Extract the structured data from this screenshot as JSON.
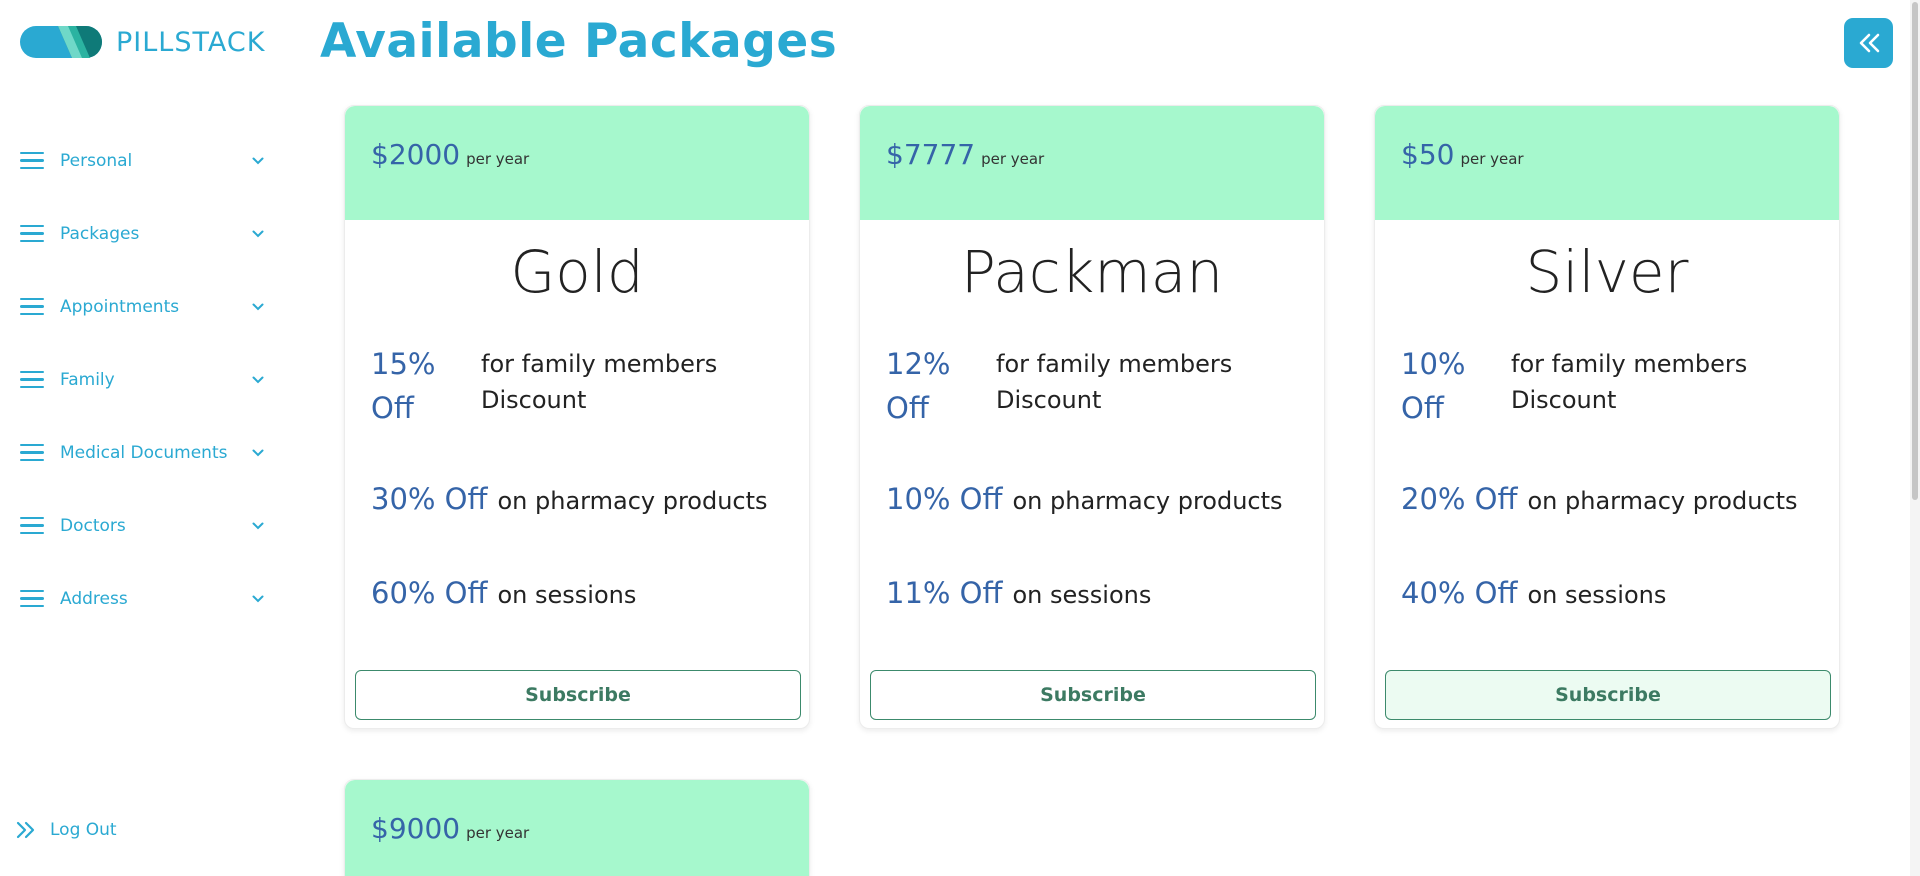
{
  "brand": {
    "name": "PILLSTACK"
  },
  "sidebar": {
    "items": [
      {
        "label": "Personal"
      },
      {
        "label": "Packages"
      },
      {
        "label": "Appointments"
      },
      {
        "label": "Family"
      },
      {
        "label": "Medical Documents"
      },
      {
        "label": "Doctors"
      },
      {
        "label": "Address"
      }
    ],
    "logout": "Log Out"
  },
  "header": {
    "title": "Available Packages"
  },
  "packages": [
    {
      "price": "$2000",
      "per": "per year",
      "name": "Gold",
      "family_pct": "15%",
      "family_off": "Off",
      "family_text": "for family members",
      "family_text2": "Discount",
      "pharmacy_pct": "30% Off",
      "pharmacy_text": "on pharmacy products",
      "sessions_pct": "60% Off",
      "sessions_text": "on sessions",
      "button": "Subscribe"
    },
    {
      "price": "$7777",
      "per": "per year",
      "name": "Packman",
      "family_pct": "12%",
      "family_off": "Off",
      "family_text": "for family members",
      "family_text2": "Discount",
      "pharmacy_pct": "10% Off",
      "pharmacy_text": "on pharmacy products",
      "sessions_pct": "11% Off",
      "sessions_text": "on sessions",
      "button": "Subscribe"
    },
    {
      "price": "$50",
      "per": "per year",
      "name": "Silver",
      "family_pct": "10%",
      "family_off": "Off",
      "family_text": "for family members",
      "family_text2": "Discount",
      "pharmacy_pct": "20% Off",
      "pharmacy_text": "on pharmacy products",
      "sessions_pct": "40% Off",
      "sessions_text": "on sessions",
      "button": "Subscribe"
    },
    {
      "price": "$9000",
      "per": "per year"
    }
  ],
  "colors": {
    "accent": "#2aa9d2",
    "card_header": "#a6f8cd",
    "price": "#3564a8",
    "button_text": "#3c7a62"
  },
  "icons": {
    "menu": "hamburger-icon",
    "chevron": "chevron-down-icon",
    "collapse": "double-chevron-left-icon",
    "logout": "double-chevron-right-icon"
  }
}
